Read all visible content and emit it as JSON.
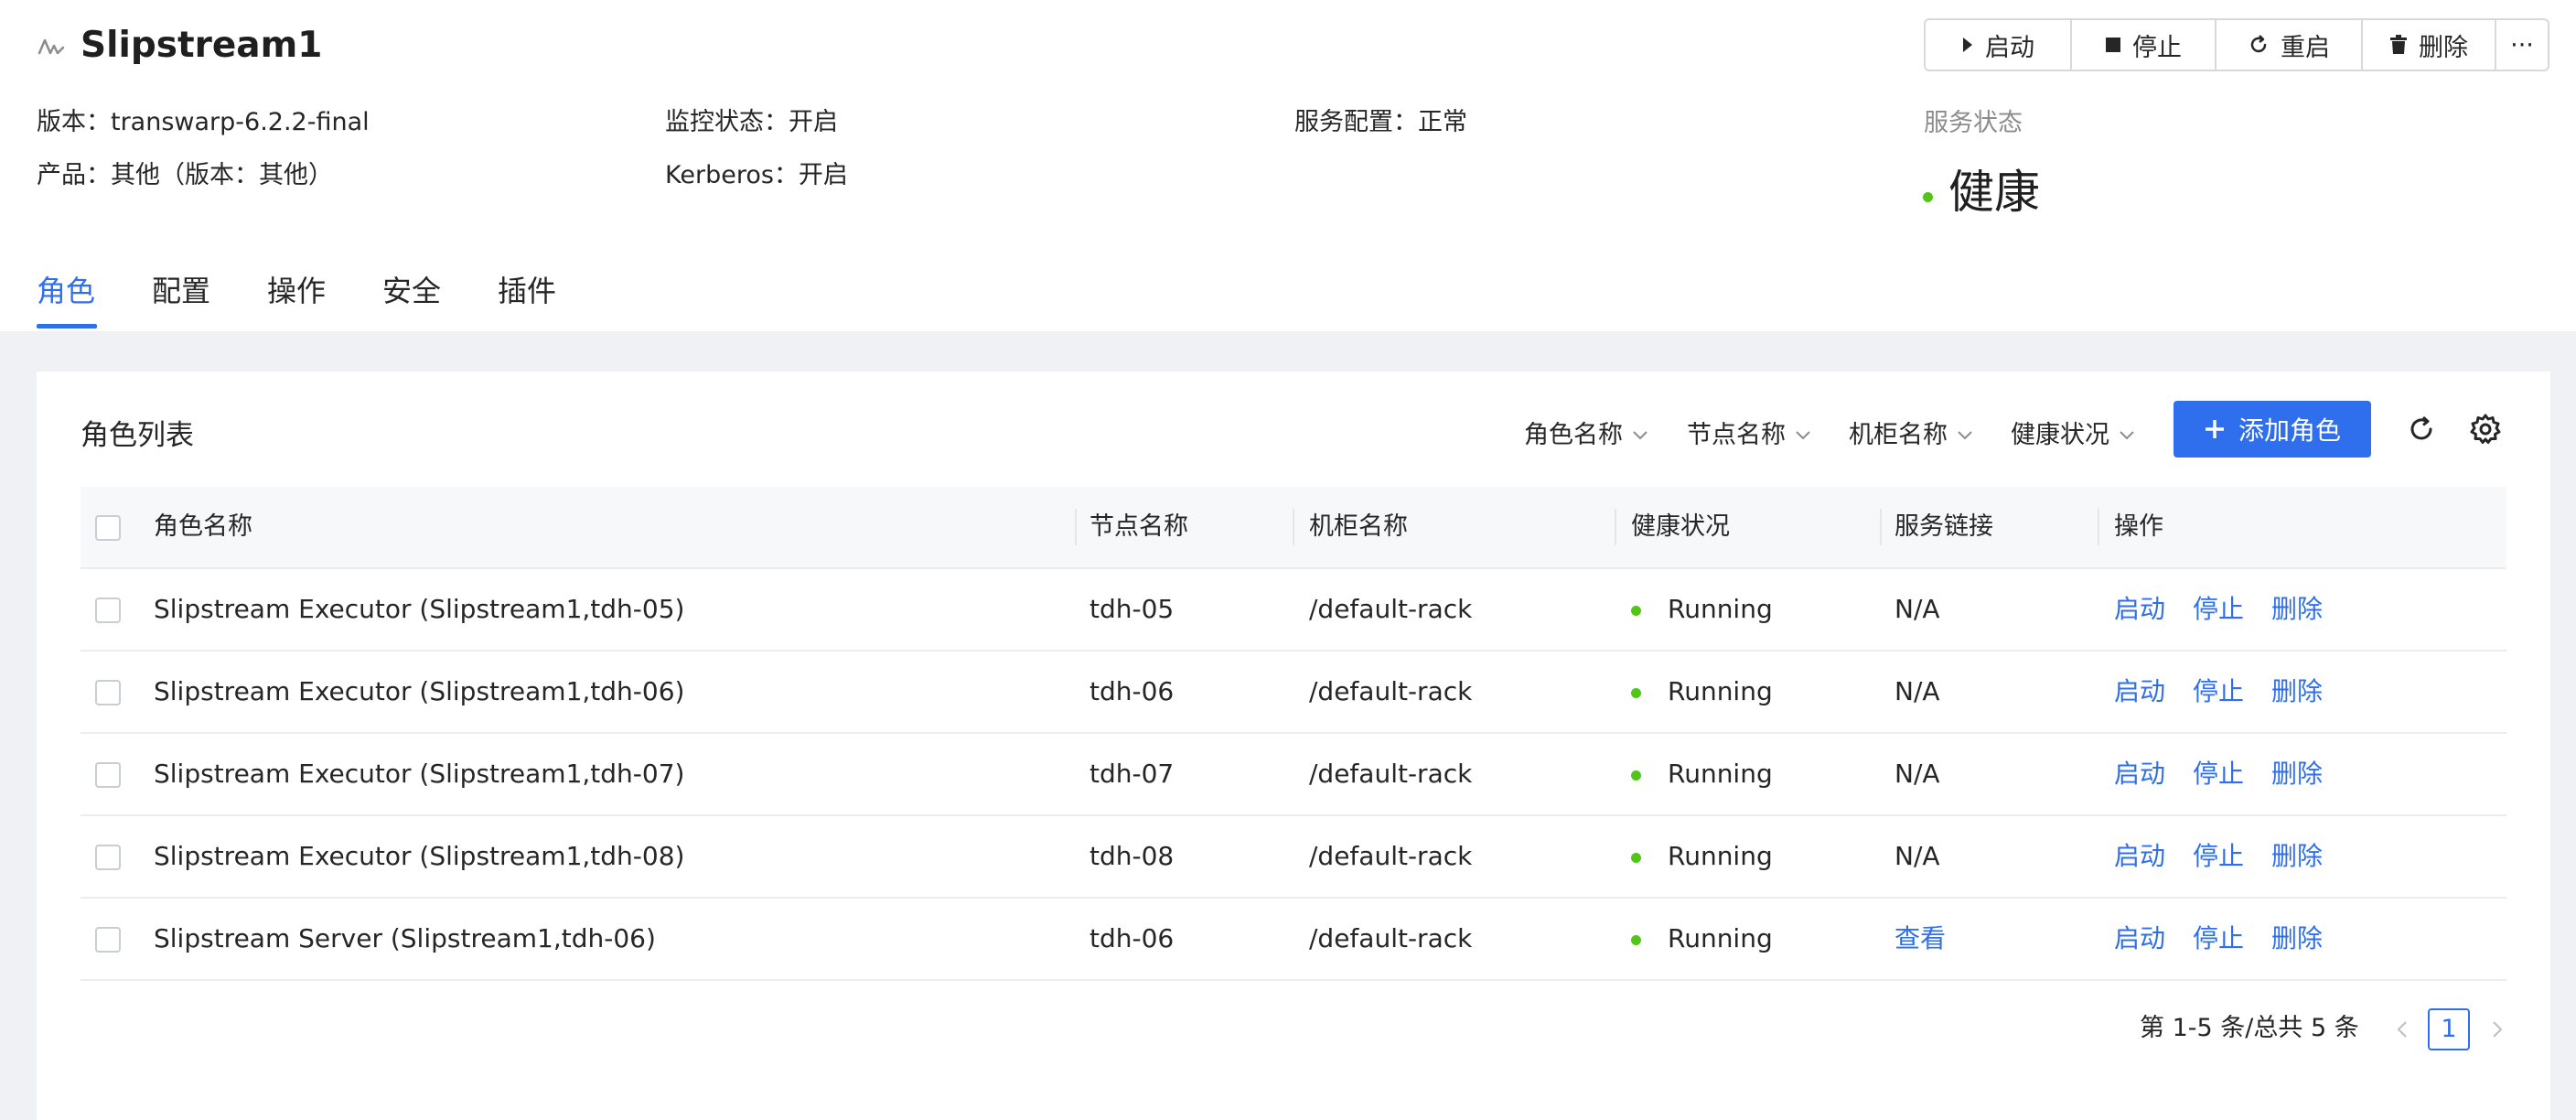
{
  "service": {
    "title": "Slipstream1",
    "icon": "service-wave-icon"
  },
  "actions": [
    {
      "label": "启动",
      "icon": "play-icon"
    },
    {
      "label": "停止",
      "icon": "stop-icon"
    },
    {
      "label": "重启",
      "icon": "restart-icon"
    },
    {
      "label": "删除",
      "icon": "trash-icon"
    },
    {
      "label": "···",
      "icon": "more-icon"
    }
  ],
  "info": {
    "version": "版本：transwarp-6.2.2-final",
    "product": "产品：其他（版本：其他）",
    "monitor": "监控状态：开启",
    "kerberos": "Kerberos：开启",
    "config": "服务配置：正常"
  },
  "status": {
    "label": "服务状态",
    "value": "健康",
    "color": "#52c41a"
  },
  "tabs": [
    "角色",
    "配置",
    "操作",
    "安全",
    "插件"
  ],
  "active_tab": "角色",
  "card": {
    "title": "角色列表",
    "filters": [
      "角色名称",
      "节点名称",
      "机柜名称",
      "健康状况"
    ],
    "add_label": "添加角色"
  },
  "table": {
    "headers": [
      "角色名称",
      "节点名称",
      "机柜名称",
      "健康状况",
      "服务链接",
      "操作"
    ],
    "rows": [
      {
        "role": "Slipstream Executor (Slipstream1,tdh-05)",
        "node": "tdh-05",
        "rack": "/default-rack",
        "health": "Running",
        "link": "N/A",
        "link_active": false
      },
      {
        "role": "Slipstream Executor (Slipstream1,tdh-06)",
        "node": "tdh-06",
        "rack": "/default-rack",
        "health": "Running",
        "link": "N/A",
        "link_active": false
      },
      {
        "role": "Slipstream Executor (Slipstream1,tdh-07)",
        "node": "tdh-07",
        "rack": "/default-rack",
        "health": "Running",
        "link": "N/A",
        "link_active": false
      },
      {
        "role": "Slipstream Executor (Slipstream1,tdh-08)",
        "node": "tdh-08",
        "rack": "/default-rack",
        "health": "Running",
        "link": "N/A",
        "link_active": false
      },
      {
        "role": "Slipstream Server (Slipstream1,tdh-06)",
        "node": "tdh-06",
        "rack": "/default-rack",
        "health": "Running",
        "link": "查看",
        "link_active": true
      }
    ],
    "row_actions": [
      "启动",
      "停止",
      "删除"
    ]
  },
  "pagination": {
    "summary": "第 1-5 条/总共 5 条",
    "current_page": "1"
  },
  "colors": {
    "accent": "#2f6fed",
    "healthy": "#52c41a"
  }
}
